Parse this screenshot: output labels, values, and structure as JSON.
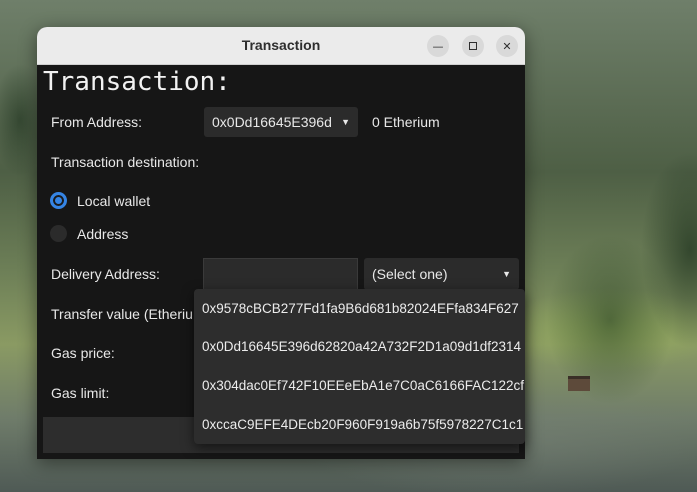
{
  "window": {
    "title": "Transaction"
  },
  "heading": "Transaction:",
  "from": {
    "label": "From Address:",
    "selected": "0x0Dd16645E396d",
    "balance": "0 Etherium"
  },
  "destination": {
    "label": "Transaction destination:",
    "options": [
      {
        "label": "Local wallet",
        "selected": true
      },
      {
        "label": "Address",
        "selected": false
      }
    ]
  },
  "delivery": {
    "label": "Delivery Address:",
    "value": "",
    "select_placeholder": "(Select one)"
  },
  "transfer": {
    "label": "Transfer value (Etheriu"
  },
  "gas_price": {
    "label": "Gas price:"
  },
  "gas_limit": {
    "label": "Gas limit:"
  },
  "dropdown": {
    "items": [
      "0x9578cBCB277Fd1fa9B6d681b82024EFfa834F627",
      "0x0Dd16645E396d62820a42A732F2D1a09d1df2314",
      "0x304dac0Ef742F10EEeEbA1e7C0aC6166FAC122cf",
      "0xccaC9EFE4DEcb20F960F919a6b75f5978227C1c1"
    ]
  },
  "colors": {
    "accent": "#3584e4",
    "background": "#161616",
    "titlebar": "#ebebeb"
  }
}
